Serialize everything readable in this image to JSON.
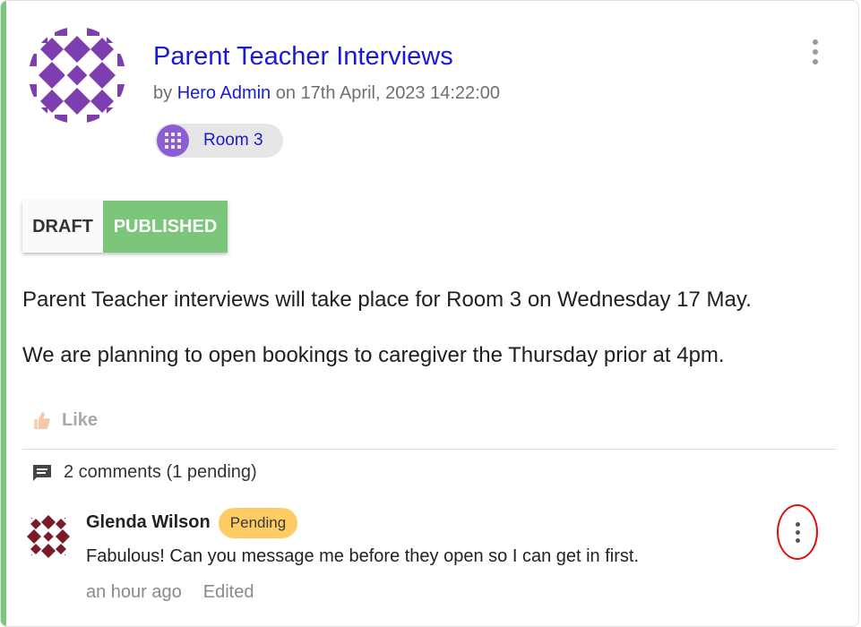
{
  "post": {
    "title": "Parent Teacher Interviews",
    "by_prefix": "by",
    "author": "Hero Admin",
    "on_prefix": "on",
    "date": "17th April, 2023 14:22:00",
    "room_tag": "Room 3",
    "status_toggle": {
      "draft_label": "DRAFT",
      "published_label": "PUBLISHED",
      "selected": "PUBLISHED"
    },
    "body": [
      "Parent Teacher interviews will take place for Room 3 on Wednesday 17 May.",
      "We are planning to open bookings to caregiver the Thursday prior at 4pm."
    ],
    "like_label": "Like",
    "accent_color": "#7cc67c"
  },
  "comments": {
    "summary": "2 comments (1 pending)",
    "items": [
      {
        "author": "Glenda Wilson",
        "badge": "Pending",
        "text": "Fabulous! Can you message me before they open so I can get in first.",
        "time": "an hour ago",
        "edited_label": "Edited"
      }
    ]
  },
  "icons": {
    "post_menu": "more-vertical-icon",
    "like": "thumbs-up-icon",
    "comments": "comment-icon",
    "comment_menu": "more-vertical-icon"
  }
}
